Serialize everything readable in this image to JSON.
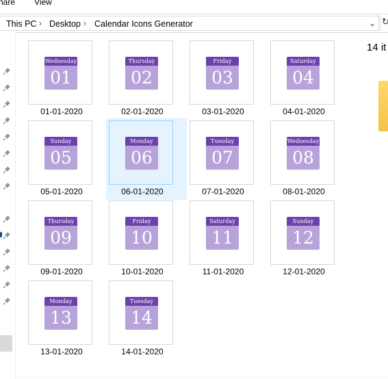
{
  "ribbon": {
    "share_label": "Share",
    "view_label": "View"
  },
  "address_bar": {
    "crumbs": [
      "This PC",
      "Desktop",
      "Calendar Icons Generator"
    ],
    "separator": ">"
  },
  "status": {
    "item_count": "14 it"
  },
  "colors": {
    "calendar_header": "#6d40b0",
    "calendar_body": "#b7a3da",
    "selection": "#e5f3ff"
  },
  "files": [
    {
      "day": "Wednesday",
      "num": "01",
      "name": "01-01-2020"
    },
    {
      "day": "Thursday",
      "num": "02",
      "name": "02-01-2020"
    },
    {
      "day": "Friday",
      "num": "03",
      "name": "03-01-2020"
    },
    {
      "day": "Saturday",
      "num": "04",
      "name": "04-01-2020"
    },
    {
      "day": "Sunday",
      "num": "05",
      "name": "05-01-2020"
    },
    {
      "day": "Monday",
      "num": "06",
      "name": "06-01-2020",
      "selected": true
    },
    {
      "day": "Tuesday",
      "num": "07",
      "name": "07-01-2020"
    },
    {
      "day": "Wednesday",
      "num": "08",
      "name": "08-01-2020"
    },
    {
      "day": "Thursday",
      "num": "09",
      "name": "09-01-2020"
    },
    {
      "day": "Friday",
      "num": "10",
      "name": "10-01-2020"
    },
    {
      "day": "Saturday",
      "num": "11",
      "name": "11-01-2020"
    },
    {
      "day": "Sunday",
      "num": "12",
      "name": "12-01-2020"
    },
    {
      "day": "Monday",
      "num": "13",
      "name": "13-01-2020"
    },
    {
      "day": "Tuesday",
      "num": "14",
      "name": "14-01-2020"
    }
  ]
}
